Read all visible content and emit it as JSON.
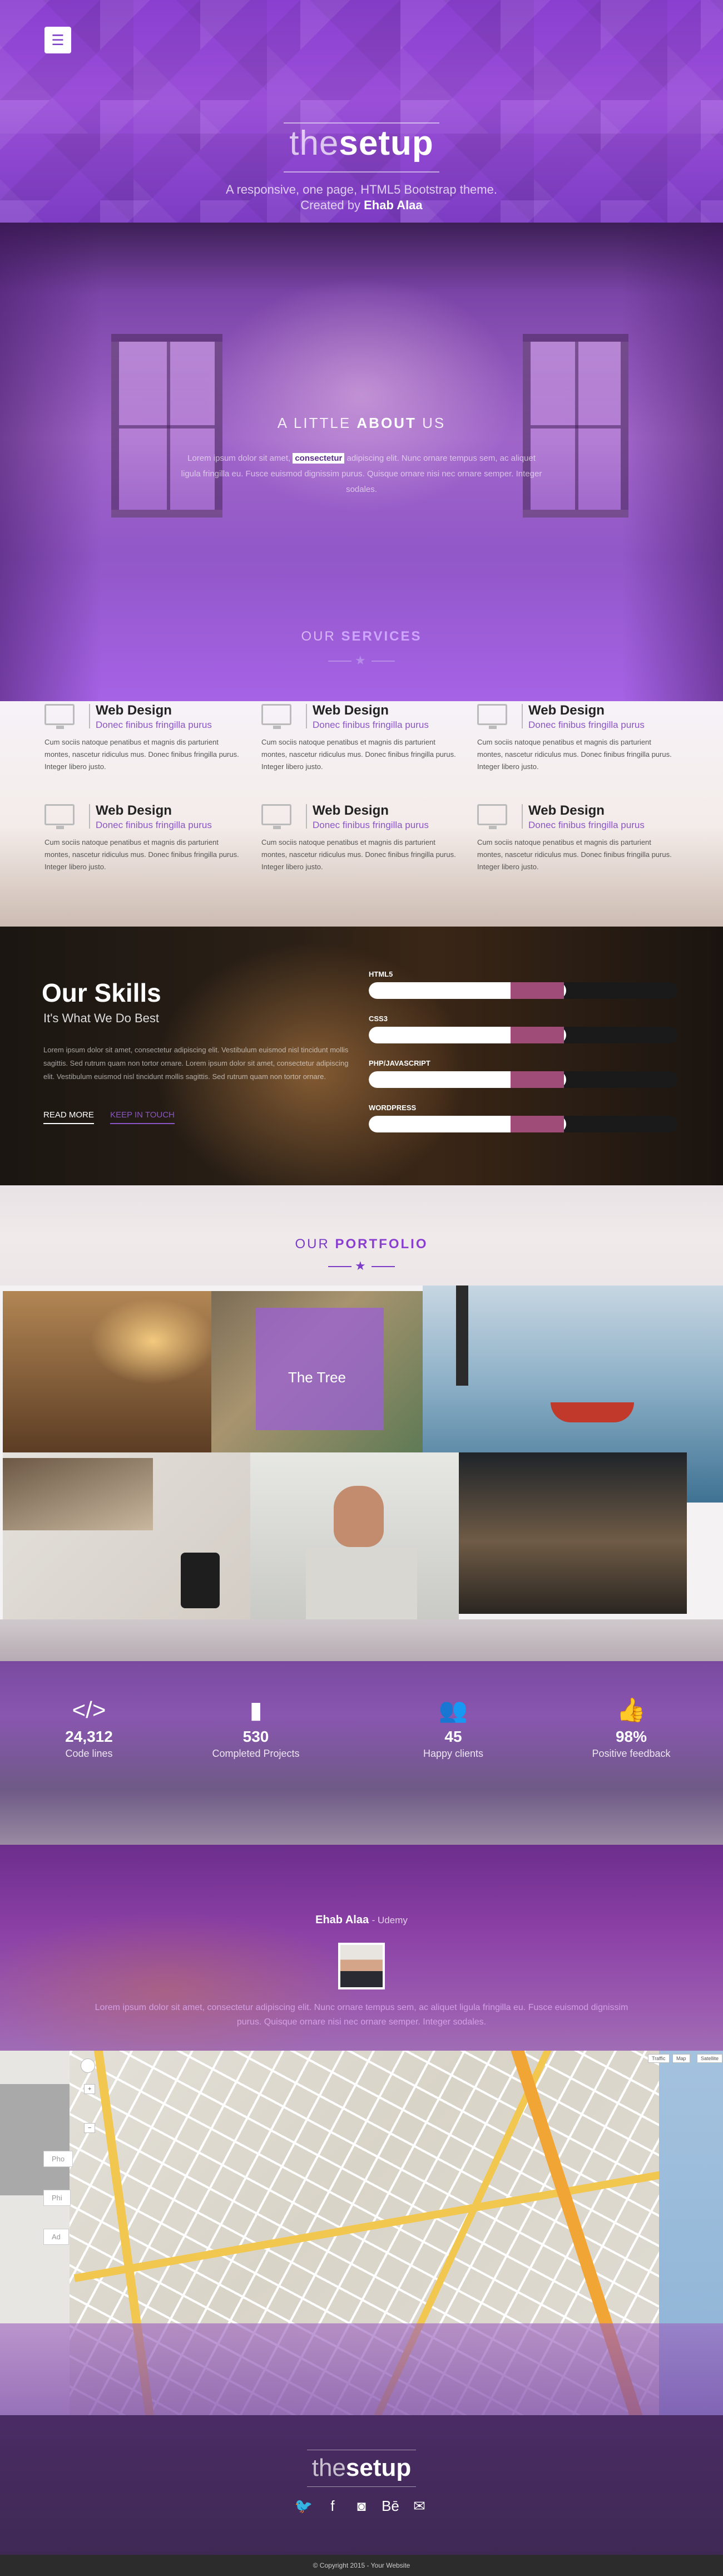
{
  "hero": {
    "menu_icon": "hamburger-menu-icon",
    "logo_thin": "the",
    "logo_bold": "setup",
    "tagline": "A responsive, one page, HTML5 Bootstrap theme.",
    "credit_prefix": "Created by",
    "credit_name": "Ehab Alaa"
  },
  "about": {
    "title_light": "A LITTLE",
    "title_bold": "ABOUT",
    "title_end": "US",
    "text_before": "Lorem ipsum dolor sit amet,",
    "text_highlight": "consectetur",
    "text_after": "adipiscing elit. Nunc ornare tempus sem, ac aliquet ligula fringilla eu. Fusce euismod dignissim purus. Quisque ornare nisi nec ornare semper. Integer sodales.",
    "services_light": "OUR",
    "services_bold": "SERVICES"
  },
  "services": {
    "items": [
      {
        "name": "Web Design",
        "sub": "Donec finibus fringilla purus",
        "desc": "Cum sociis natoque penatibus et magnis dis parturient montes, nascetur ridiculus mus. Donec finibus fringilla purus. Integer libero justo."
      },
      {
        "name": "Web Design",
        "sub": "Donec finibus fringilla purus",
        "desc": "Cum sociis natoque penatibus et magnis dis parturient montes, nascetur ridiculus mus. Donec finibus fringilla purus. Integer libero justo."
      },
      {
        "name": "Web Design",
        "sub": "Donec finibus fringilla purus",
        "desc": "Cum sociis natoque penatibus et magnis dis parturient montes, nascetur ridiculus mus. Donec finibus fringilla purus. Integer libero justo."
      },
      {
        "name": "Web Design",
        "sub": "Donec finibus fringilla purus",
        "desc": "Cum sociis natoque penatibus et magnis dis parturient montes, nascetur ridiculus mus. Donec finibus fringilla purus. Integer libero justo."
      },
      {
        "name": "Web Design",
        "sub": "Donec finibus fringilla purus",
        "desc": "Cum sociis natoque penatibus et magnis dis parturient montes, nascetur ridiculus mus. Donec finibus fringilla purus. Integer libero justo."
      },
      {
        "name": "Web Design",
        "sub": "Donec finibus fringilla purus",
        "desc": "Cum sociis natoque penatibus et magnis dis parturient montes, nascetur ridiculus mus. Donec finibus fringilla purus. Integer libero justo."
      }
    ],
    "icon": "monitor-icon"
  },
  "skills": {
    "title": "Our Skills",
    "subtitle": "It's What We Do Best",
    "text": "Lorem ipsum dolor sit amet, consectetur adipiscing elit. Vestibulum euismod nisl tincidunt mollis sagittis. Sed rutrum quam non tortor ornare. Lorem ipsum dolor sit amet, consectetur adipiscing elit. Vestibulum euismod nisl tincidunt mollis sagittis. Sed rutrum quam non tortor ornare.",
    "read_more": "READ MORE",
    "keep_in_touch": "KEEP IN TOUCH",
    "bars": [
      {
        "label": "HTML5",
        "percent": 64
      },
      {
        "label": "CSS3",
        "percent": 64
      },
      {
        "label": "PHP/JAVASCRIPT",
        "percent": 64
      },
      {
        "label": "WORDPRESS",
        "percent": 64
      }
    ],
    "knob_color": "#a04c79"
  },
  "portfolio": {
    "title_light": "OUR",
    "title_bold": "PORTFOLIO",
    "caption": "The Tree"
  },
  "counters": [
    {
      "icon": "code-icon",
      "glyph": "</>",
      "value": "24,312",
      "label": "Code lines"
    },
    {
      "icon": "file-icon",
      "glyph": "▮",
      "value": "530",
      "label": "Completed Projects"
    },
    {
      "icon": "users-icon",
      "glyph": "👥",
      "value": "45",
      "label": "Happy clients"
    },
    {
      "icon": "thumbs-up-icon",
      "glyph": "👍",
      "value": "98%",
      "label": "Positive feedback"
    }
  ],
  "testimonial": {
    "name": "Ehab Alaa",
    "company": "- Udemy",
    "text": "Lorem ipsum dolor sit amet, consectetur adipiscing elit. Nunc ornare tempus sem, ac aliquet ligula fringilla eu. Fusce euismod dignissim purus. Quisque ornare nisi nec ornare semper. Integer sodales."
  },
  "map": {
    "controls": [
      "Traffic",
      "Map",
      "Satellite"
    ],
    "zoom_in": "+",
    "zoom_out": "−",
    "side_buttons": [
      "Pho",
      "Phi",
      "Ad"
    ]
  },
  "footer": {
    "logo_thin": "the",
    "logo_bold": "setup",
    "socials": [
      {
        "icon": "twitter-icon",
        "glyph": "🐦"
      },
      {
        "icon": "facebook-icon",
        "glyph": "f"
      },
      {
        "icon": "instagram-icon",
        "glyph": "◙"
      },
      {
        "icon": "behance-icon",
        "glyph": "Bē"
      },
      {
        "icon": "mail-icon",
        "glyph": "✉"
      }
    ],
    "copyright": "© Copyright 2015 - Your Website"
  },
  "colors": {
    "accent": "#8a3fd0",
    "purple_text": "#8a55c4"
  }
}
